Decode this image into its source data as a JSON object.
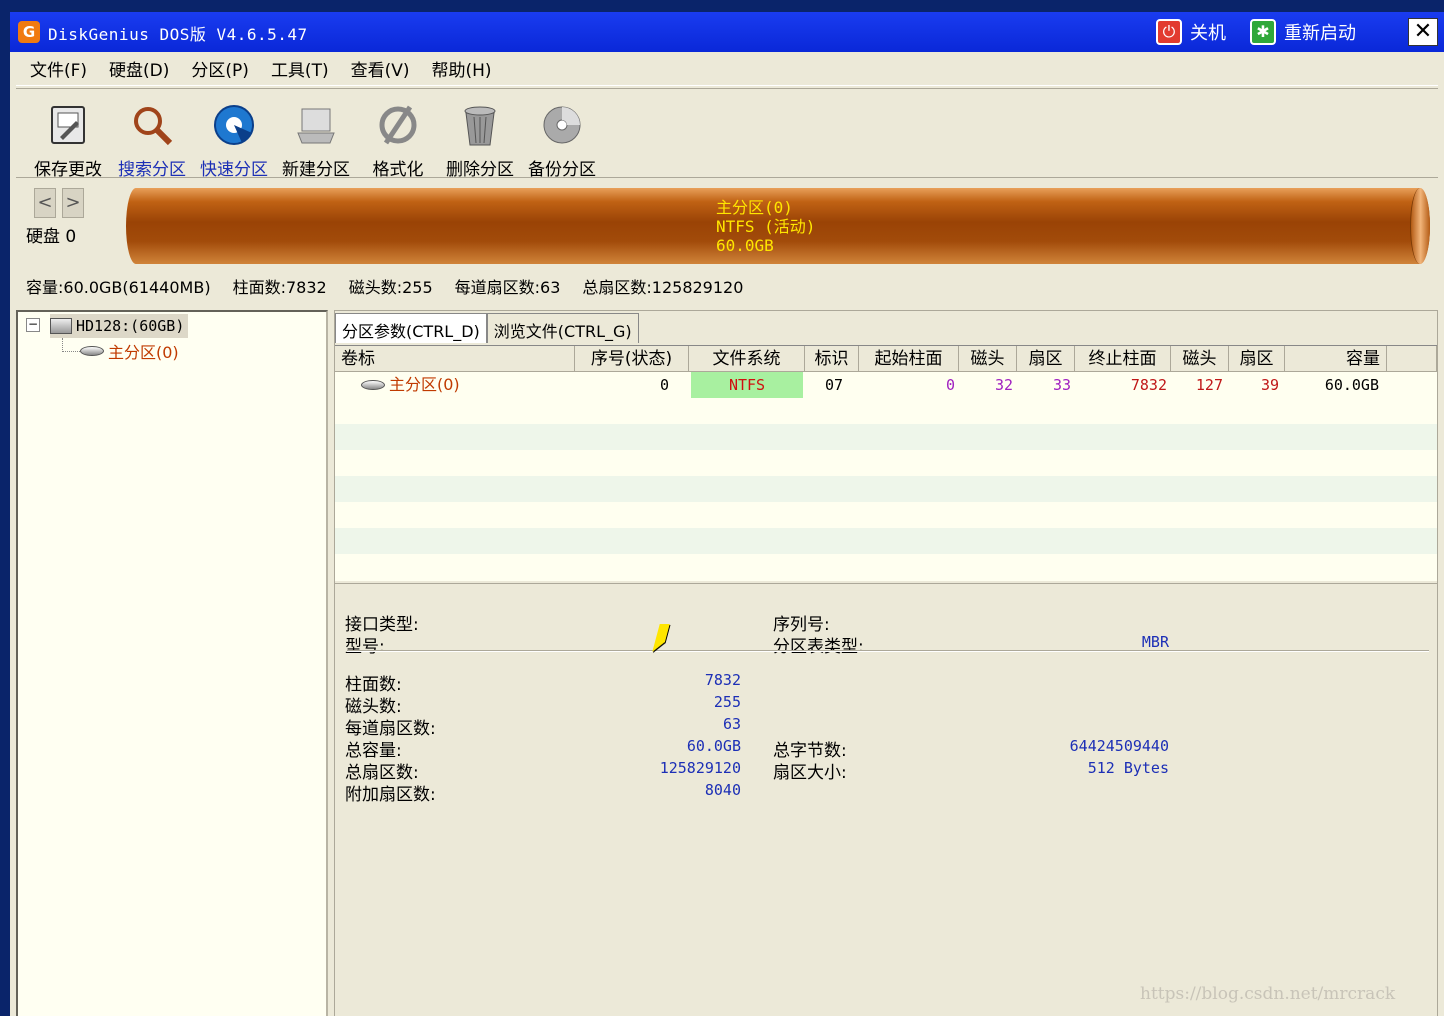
{
  "window": {
    "title": "DiskGenius DOS版 V4.6.5.47",
    "shutdown_label": "关机",
    "restart_label": "重新启动",
    "close_glyph": "✕"
  },
  "menu": [
    "文件(F)",
    "硬盘(D)",
    "分区(P)",
    "工具(T)",
    "查看(V)",
    "帮助(H)"
  ],
  "toolbar": [
    {
      "label": "保存更改",
      "icon": "save-icon"
    },
    {
      "label": "搜索分区",
      "icon": "search-partition-icon"
    },
    {
      "label": "快速分区",
      "icon": "quick-partition-icon"
    },
    {
      "label": "新建分区",
      "icon": "new-partition-icon"
    },
    {
      "label": "格式化",
      "icon": "format-icon"
    },
    {
      "label": "删除分区",
      "icon": "delete-partition-icon"
    },
    {
      "label": "备份分区",
      "icon": "backup-partition-icon"
    }
  ],
  "disk_nav": {
    "label": "硬盘 0",
    "prev": "<",
    "next": ">"
  },
  "partition_bar": {
    "line1": "主分区(0)",
    "line2": "NTFS (活动)",
    "line3": "60.0GB"
  },
  "disk_info": [
    "容量:60.0GB(61440MB)",
    "柱面数:7832",
    "磁头数:255",
    "每道扇区数:63",
    "总扇区数:125829120"
  ],
  "tree": {
    "disk": "HD128:(60GB)",
    "partition": "主分区(0)",
    "toggle": "−"
  },
  "tabs": [
    "分区参数(CTRL_D)",
    "浏览文件(CTRL_G)"
  ],
  "table": {
    "headers": [
      "卷标",
      "序号(状态)",
      "文件系统",
      "标识",
      "起始柱面",
      "磁头",
      "扇区",
      "终止柱面",
      "磁头",
      "扇区",
      "容量"
    ],
    "row": {
      "label": "主分区(0)",
      "index": "0",
      "fs": "NTFS",
      "id": "07",
      "start_cyl": "0",
      "start_head": "32",
      "start_sector": "33",
      "end_cyl": "7832",
      "end_head": "127",
      "end_sector": "39",
      "capacity": "60.0GB"
    }
  },
  "details": {
    "interface_type_label": "接口类型:",
    "model_label": "型号:",
    "serial_label": "序列号:",
    "partition_table_label": "分区表类型:",
    "partition_table_value": "MBR",
    "cylinders_label": "柱面数:",
    "cylinders_value": "7832",
    "heads_label": "磁头数:",
    "heads_value": "255",
    "sectors_per_track_label": "每道扇区数:",
    "sectors_per_track_value": "63",
    "total_capacity_label": "总容量:",
    "total_capacity_value": "60.0GB",
    "total_bytes_label": "总字节数:",
    "total_bytes_value": "64424509440",
    "total_sectors_label": "总扇区数:",
    "total_sectors_value": "125829120",
    "sector_size_label": "扇区大小:",
    "sector_size_value": "512 Bytes",
    "extra_sectors_label": "附加扇区数:",
    "extra_sectors_value": "8040"
  },
  "watermark": "https://blog.csdn.net/mrcrack",
  "colors": {
    "title_bar": "#0a28d8",
    "partition": "#9a4306",
    "value_blue": "#1c2fb6",
    "fs_green": "#a8f0a0"
  }
}
